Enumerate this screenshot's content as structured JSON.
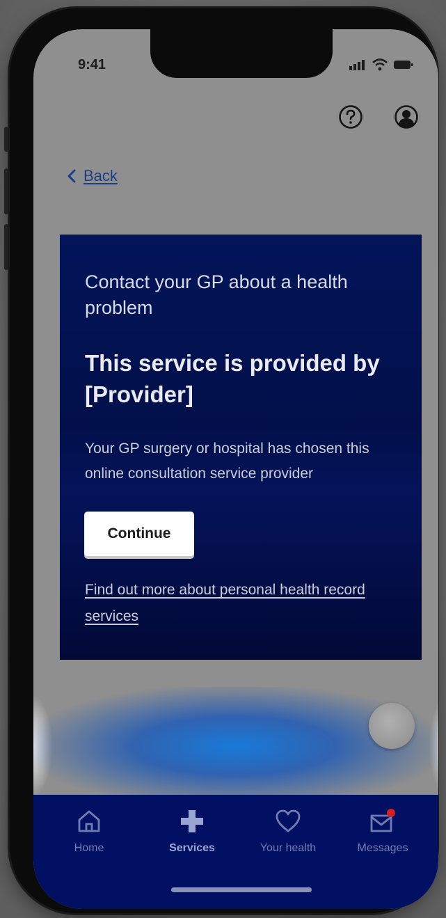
{
  "status_bar": {
    "time": "9:41"
  },
  "header": {
    "help_icon": "question-circle-icon",
    "account_icon": "user-circle-icon"
  },
  "navigation": {
    "back_label": "Back"
  },
  "card": {
    "eyebrow": "Contact your GP about a health problem",
    "title": "This service is provided by [Provider]",
    "body": "Your GP surgery or hospital has chosen this online consultation service provider",
    "continue_label": "Continue",
    "more_link": "Find out more about personal health record services"
  },
  "tabbar": {
    "items": [
      {
        "label": "Home",
        "icon": "home-icon"
      },
      {
        "label": "Services",
        "icon": "plus-cross-icon"
      },
      {
        "label": "Your health",
        "icon": "heart-icon"
      },
      {
        "label": "Messages",
        "icon": "envelope-icon"
      }
    ],
    "active": "Services"
  },
  "colors": {
    "card_background": "#021559",
    "tabbar_background": "#021064",
    "link": "#1a3d8a",
    "notification_dot": "#d42020"
  }
}
